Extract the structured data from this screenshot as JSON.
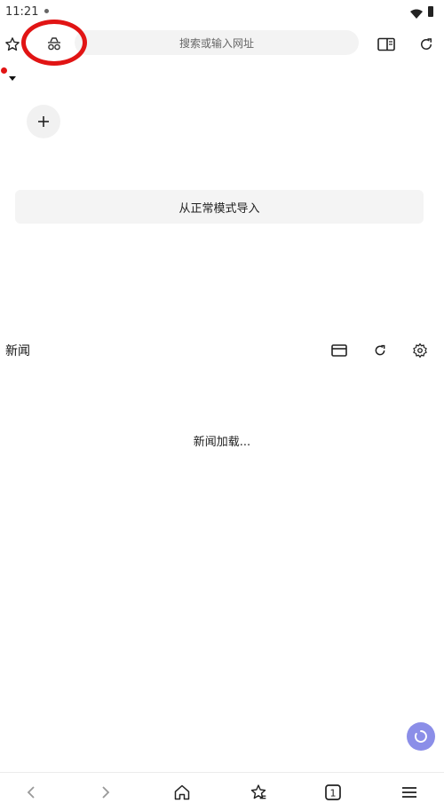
{
  "status_bar": {
    "time": "11:21",
    "icons": [
      "notification-dot",
      "wifi-icon",
      "battery-icon"
    ]
  },
  "toolbar": {
    "icons": [
      "star-outline-icon",
      "incognito-icon",
      "reader-mode-icon",
      "reload-icon"
    ],
    "search_placeholder": "搜索或输入网址"
  },
  "highlight": {
    "color": "#e11414",
    "target": "incognito-icon"
  },
  "shortcuts": {
    "add_icon": "plus-icon"
  },
  "import_button": {
    "label": "从正常模式导入"
  },
  "news": {
    "title": "新闻",
    "icons": [
      "card-view-icon",
      "refresh-icon",
      "settings-icon"
    ],
    "loading_text": "新闻加载..."
  },
  "floating_button": {
    "icon": "spinner-icon",
    "color": "#8b8ee8"
  },
  "bottom_nav": {
    "icons": [
      "back-icon",
      "forward-icon",
      "home-icon",
      "bookmarks-icon",
      "tabs-icon",
      "menu-icon"
    ],
    "tab_count": "1"
  },
  "colors": {
    "accent": "#8b8ee8",
    "annotation": "#e11414",
    "surface": "#f3f3f3"
  }
}
